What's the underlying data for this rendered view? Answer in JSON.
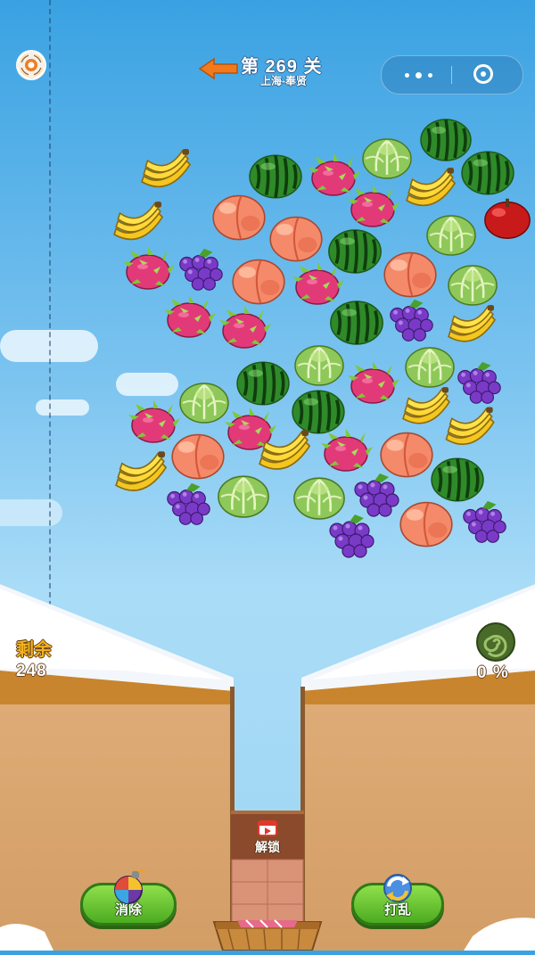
{
  "header": {
    "level_title": "第 269 关",
    "level_subtitle": "上海-奉贤"
  },
  "stats": {
    "remaining_label": "剩余",
    "remaining_count": "248",
    "progress_percent": "0 %"
  },
  "slot": {
    "unlock_label": "解锁"
  },
  "buttons": {
    "eliminate_label": "消除",
    "shuffle_label": "打乱"
  },
  "colors": {
    "sky_top": "#3aa2e2",
    "ground": "#d9a772",
    "button_green": "#5cba28"
  },
  "fruit_types": [
    "banana",
    "watermelon",
    "dragon-fruit",
    "cabbage",
    "peach",
    "grape",
    "apple"
  ]
}
